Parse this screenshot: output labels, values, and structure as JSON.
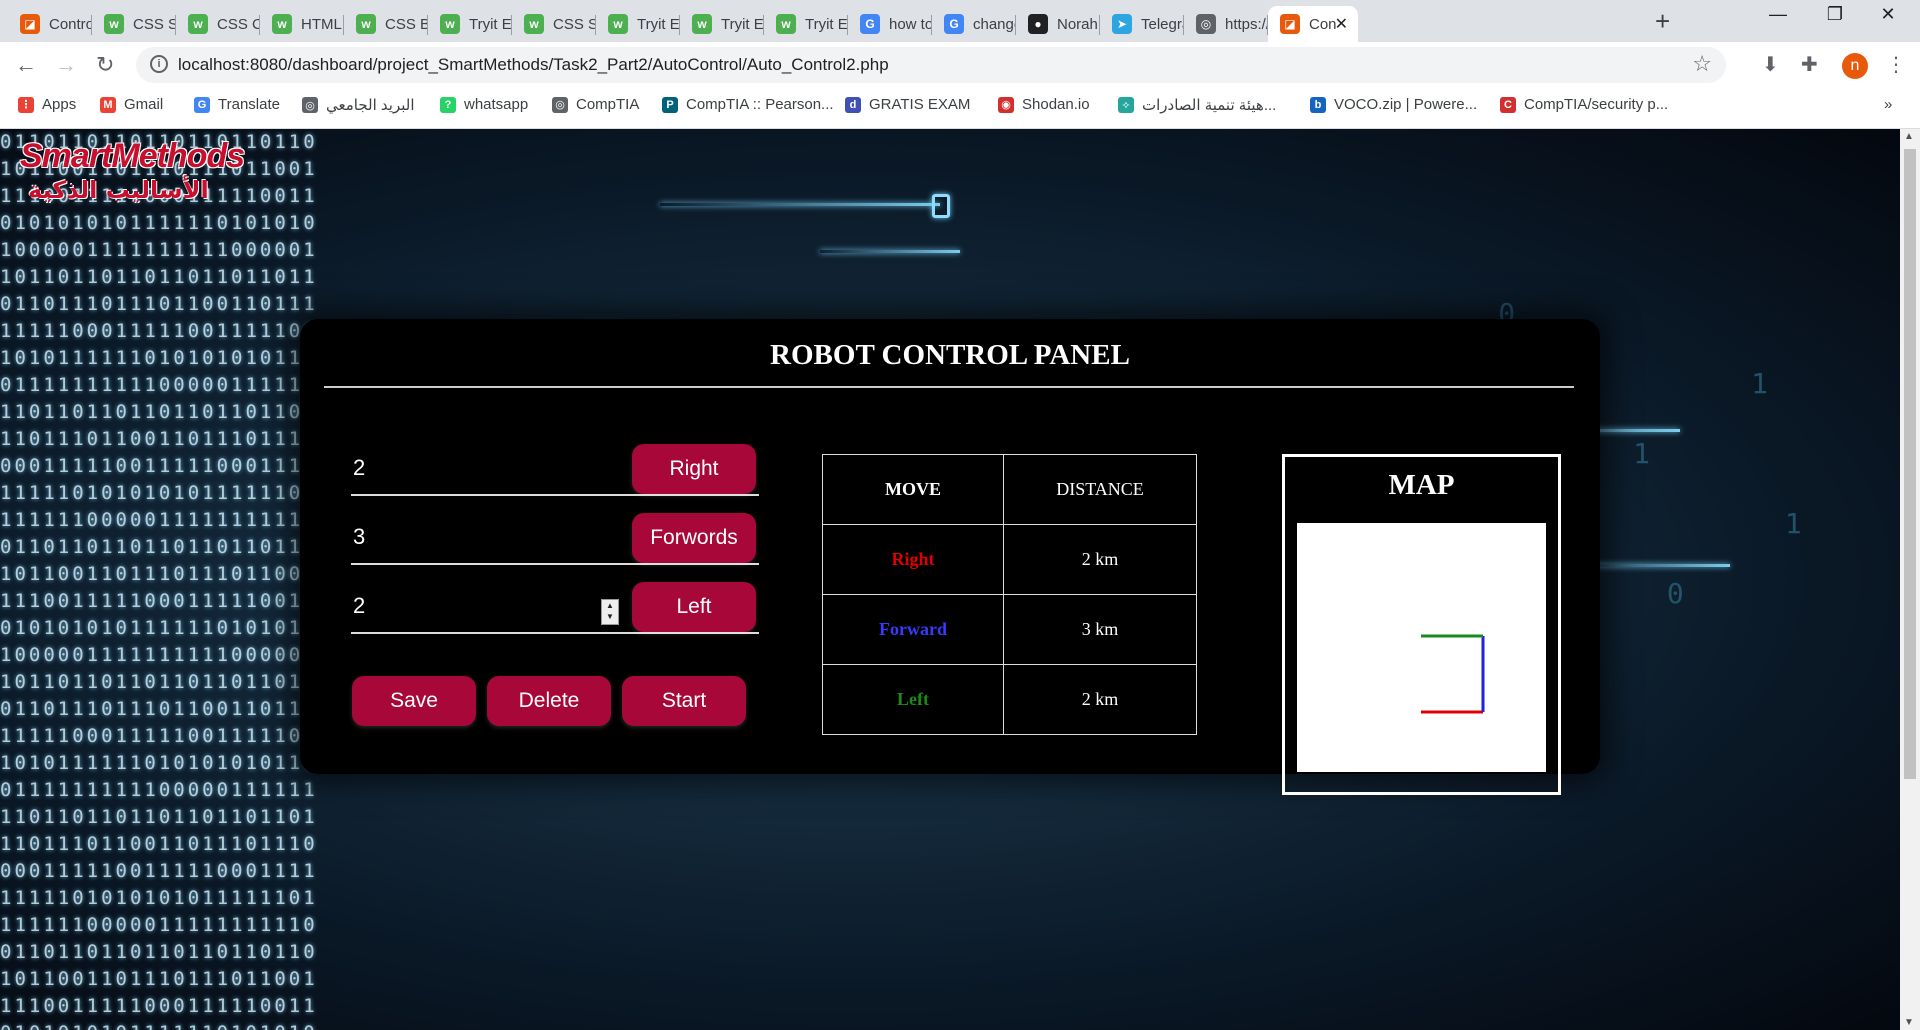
{
  "browser": {
    "tabs": [
      {
        "title": "Control",
        "color": "#e8590c",
        "glyph": "◪"
      },
      {
        "title": "CSS Sty",
        "color": "#4caf50",
        "glyph": "w"
      },
      {
        "title": "CSS Col",
        "color": "#4caf50",
        "glyph": "w"
      },
      {
        "title": "HTML C",
        "color": "#4caf50",
        "glyph": "w"
      },
      {
        "title": "CSS Bor",
        "color": "#4caf50",
        "glyph": "w"
      },
      {
        "title": "Tryit Ed",
        "color": "#4caf50",
        "glyph": "w"
      },
      {
        "title": "CSS Sty",
        "color": "#4caf50",
        "glyph": "w"
      },
      {
        "title": "Tryit Ed",
        "color": "#4caf50",
        "glyph": "w"
      },
      {
        "title": "Tryit Ed",
        "color": "#4caf50",
        "glyph": "w"
      },
      {
        "title": "Tryit Ed",
        "color": "#4caf50",
        "glyph": "w"
      },
      {
        "title": "how to",
        "color": "#4285f4",
        "glyph": "G"
      },
      {
        "title": "change",
        "color": "#4285f4",
        "glyph": "G"
      },
      {
        "title": "NorahF",
        "color": "#202124",
        "glyph": "●"
      },
      {
        "title": "Telegra",
        "color": "#2ca5e0",
        "glyph": "➤"
      },
      {
        "title": "https://",
        "color": "#5f6368",
        "glyph": "◎"
      },
      {
        "title": "Con",
        "color": "#e8590c",
        "glyph": "◪"
      }
    ],
    "url": "localhost:8080/dashboard/project_SmartMethods/Task2_Part2/AutoControl/Auto_Control2.php",
    "profile_initial": "n",
    "bookmarks": [
      {
        "label": "Apps",
        "color": "#ea4335",
        "glyph": "⋮"
      },
      {
        "label": "Gmail",
        "color": "#ea4335",
        "glyph": "M"
      },
      {
        "label": "Translate",
        "color": "#4285f4",
        "glyph": "G"
      },
      {
        "label": "البريد الجامعي",
        "color": "#5f6368",
        "glyph": "◎"
      },
      {
        "label": "whatsapp",
        "color": "#25d366",
        "glyph": "?"
      },
      {
        "label": "CompTIA",
        "color": "#5f6368",
        "glyph": "◎"
      },
      {
        "label": "CompTIA :: Pearson...",
        "color": "#00627a",
        "glyph": "P"
      },
      {
        "label": "GRATIS EXAM",
        "color": "#3f51b5",
        "glyph": "d"
      },
      {
        "label": "Shodan.io",
        "color": "#d32f2f",
        "glyph": "◉"
      },
      {
        "label": "هيئة تنمية الصادرات...",
        "color": "#26a69a",
        "glyph": "✧"
      },
      {
        "label": "VOCO.zip | Powere...",
        "color": "#1565c0",
        "glyph": "b"
      },
      {
        "label": "CompTIA/security p...",
        "color": "#d32f2f",
        "glyph": "C"
      }
    ]
  },
  "logo": {
    "en": "SmartMethods",
    "ar": "الأساليب الذكية"
  },
  "panel": {
    "title": "ROBOT CONTROL PANEL",
    "inputs": [
      {
        "value": "2",
        "button": "Right"
      },
      {
        "value": "3",
        "button": "Forwords"
      },
      {
        "value": "2",
        "button": "Left"
      }
    ],
    "actions": [
      "Save",
      "Delete",
      "Start"
    ],
    "table": {
      "headers": [
        "MOVE",
        "DISTANCE"
      ],
      "rows": [
        {
          "move": "Right",
          "distance": "2 km",
          "color": "#e00000"
        },
        {
          "move": "Forward",
          "distance": "3 km",
          "color": "#3a3aff"
        },
        {
          "move": "Left",
          "distance": "2 km",
          "color": "#1a8a1a"
        }
      ]
    },
    "map": {
      "title": "MAP",
      "segment_colors": [
        "#e00000",
        "#2020e0",
        "#1a8a1a"
      ]
    }
  }
}
